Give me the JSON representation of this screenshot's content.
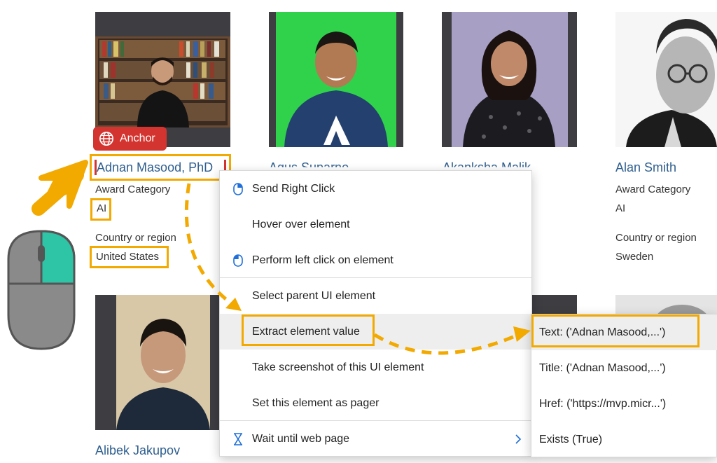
{
  "cards": {
    "adnan": {
      "name": "Adnan Masood, PhD",
      "award_label": "Award Category",
      "award_value": "AI",
      "country_label": "Country or region",
      "country_value": "United States"
    },
    "agus": {
      "name": "Agus Suparno"
    },
    "akanksha": {
      "name": "Akanksha Malik"
    },
    "alan": {
      "name": "Alan Smith",
      "award_label": "Award Category",
      "award_value": "AI",
      "country_label": "Country or region",
      "country_value": "Sweden"
    },
    "alibek": {
      "name": "Alibek Jakupov"
    }
  },
  "anchor_badge": {
    "label": "Anchor",
    "icon": "globe-icon"
  },
  "context_menu": {
    "items": [
      {
        "label": "Send Right Click",
        "icon": "mouse-right-icon"
      },
      {
        "label": "Hover over element"
      },
      {
        "label": "Perform left click on element",
        "icon": "mouse-left-icon"
      },
      {
        "label": "Select parent UI element"
      },
      {
        "label": "Extract element value",
        "has_submenu": true
      },
      {
        "label": "Take screenshot of this UI element"
      },
      {
        "label": "Set this element as pager"
      },
      {
        "label": "Wait until web page",
        "icon": "hourglass-icon",
        "has_submenu": true
      }
    ]
  },
  "submenu": {
    "items": [
      {
        "label": "Text:  ('Adnan Masood,...')"
      },
      {
        "label": "Title:  ('Adnan Masood,...')"
      },
      {
        "label": "Href:  ('https://mvp.micr...')"
      },
      {
        "label": "Exists (True)"
      }
    ]
  },
  "colors": {
    "highlight": "#f2a900",
    "badge": "#d3342f",
    "link": "#2f5f8f",
    "mouse_accent": "#2ec4a6"
  }
}
